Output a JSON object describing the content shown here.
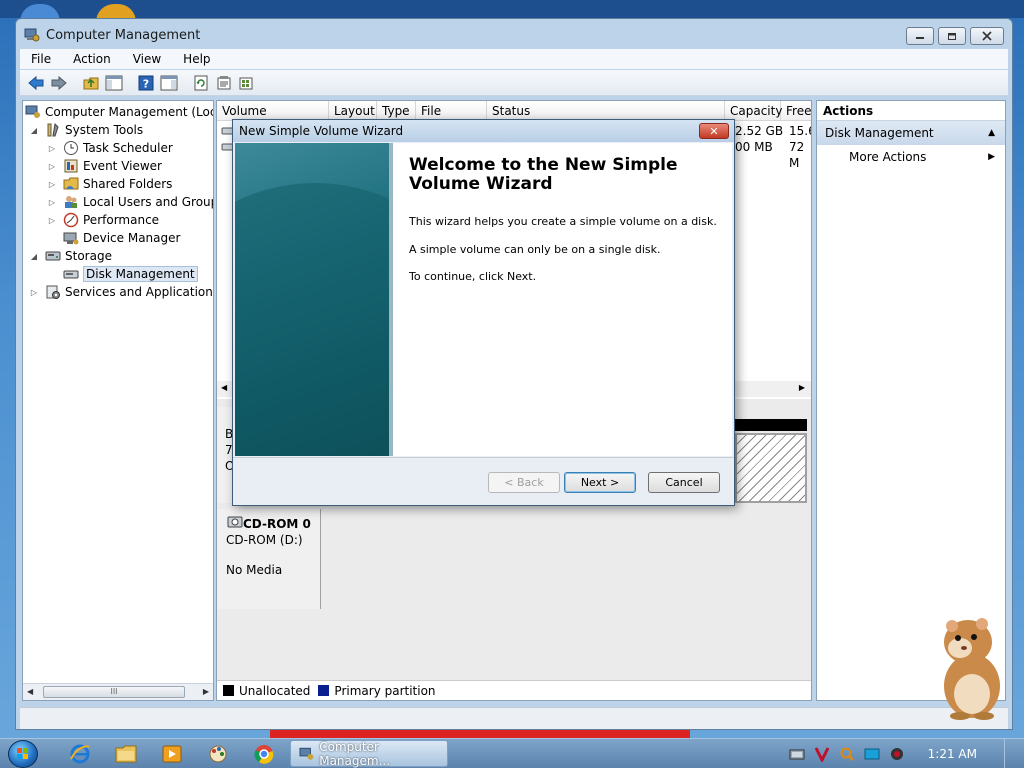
{
  "window": {
    "title": "Computer Management",
    "minimize_label": "▭",
    "maximize_label": "⧉",
    "close_label": "✕"
  },
  "menu": [
    "File",
    "Action",
    "View",
    "Help"
  ],
  "toolbar": {
    "icons": [
      "back-arrow-icon",
      "forward-arrow-icon",
      "up-folder-icon",
      "show-hide-tree-icon",
      "help-icon",
      "show-hide-action-pane-icon",
      "refresh-icon",
      "properties-icon",
      "export-icon"
    ]
  },
  "tree": {
    "root": "Computer Management (Local",
    "system_tools": "System Tools",
    "task_scheduler": "Task Scheduler",
    "event_viewer": "Event Viewer",
    "shared_folders": "Shared Folders",
    "local_users": "Local Users and Groups",
    "performance": "Performance",
    "device_manager": "Device Manager",
    "storage": "Storage",
    "disk_management": "Disk Management",
    "services": "Services and Applications",
    "scroll_grip": "III"
  },
  "volume_list": {
    "columns": [
      "Volume",
      "Layout",
      "Type",
      "File System",
      "Status",
      "Capacity",
      "Free"
    ],
    "rows": [
      {
        "capacity": "2.52 GB",
        "free": "15.6"
      },
      {
        "capacity": "00 MB",
        "free": "72 M"
      }
    ]
  },
  "disk_panel": {
    "disk0_partial": [
      "B",
      "7.",
      "O"
    ],
    "cdrom_title": "CD-ROM 0",
    "cdrom_type": "CD-ROM (D:)",
    "cdrom_status": "No Media"
  },
  "legend": {
    "unallocated": "Unallocated",
    "primary": "Primary partition",
    "unallocated_color": "#000000",
    "primary_color": "#0a1f8f"
  },
  "actions": {
    "header": "Actions",
    "section": "Disk Management",
    "more": "More Actions"
  },
  "dialog": {
    "title": "New Simple Volume Wizard",
    "close_label": "✕",
    "heading": "Welcome to the New Simple Volume Wizard",
    "para1": "This wizard helps you create a simple volume on a disk.",
    "para2": "A simple volume can only be on a single disk.",
    "para3": "To continue, click Next.",
    "back_label": "< Back",
    "next_label": "Next >",
    "cancel_label": "Cancel"
  },
  "taskbar": {
    "task_label": "Computer Managem...",
    "clock": "1:21 AM",
    "pinned": [
      "internet-explorer-icon",
      "explorer-folder-icon",
      "media-player-icon",
      "paint-icon",
      "chrome-icon"
    ]
  },
  "colors": {
    "accent": "#2a6fb8",
    "titlebar": "#bcd3ea",
    "close_red": "#c23a24"
  }
}
